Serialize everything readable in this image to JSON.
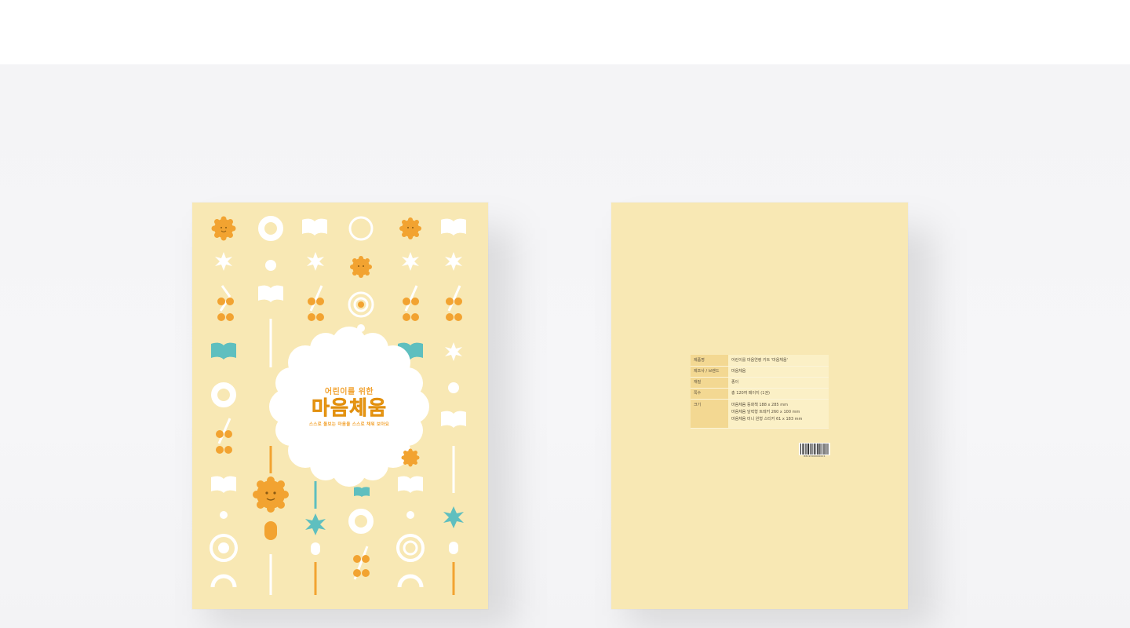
{
  "scene": {
    "page_background": "#ffffff",
    "stage_background": "#f4f4f6"
  },
  "front_cover": {
    "background_color": "#f8e8b4",
    "accent_orange": "#f2a331",
    "accent_teal": "#5fbfbf",
    "accent_white": "#ffffff",
    "subtitle": "어린이를 위한",
    "title": "마음체움",
    "tagline": "스스로 돌보는 마음을 스스로 채워 보아요"
  },
  "back_cover": {
    "background_color": "#f8e8b4",
    "spec_table": [
      {
        "key": "제품명",
        "value": "어린이를 마음연령 키트 '마음체움'"
      },
      {
        "key": "제조사 / 브랜드",
        "value": "마음체움"
      },
      {
        "key": "재질",
        "value": "종이"
      },
      {
        "key": "쪽수",
        "value": "총 120여 페이지 (1권)"
      },
      {
        "key": "크기",
        "lines": [
          "마음체움   동화책  188 x 285 mm",
          "마음체움   달력형 트레커  260 x 100 mm",
          "마음체움   미니 원형 스티커  61 x 183 mm"
        ]
      }
    ],
    "barcode_number": "8819300000001"
  }
}
